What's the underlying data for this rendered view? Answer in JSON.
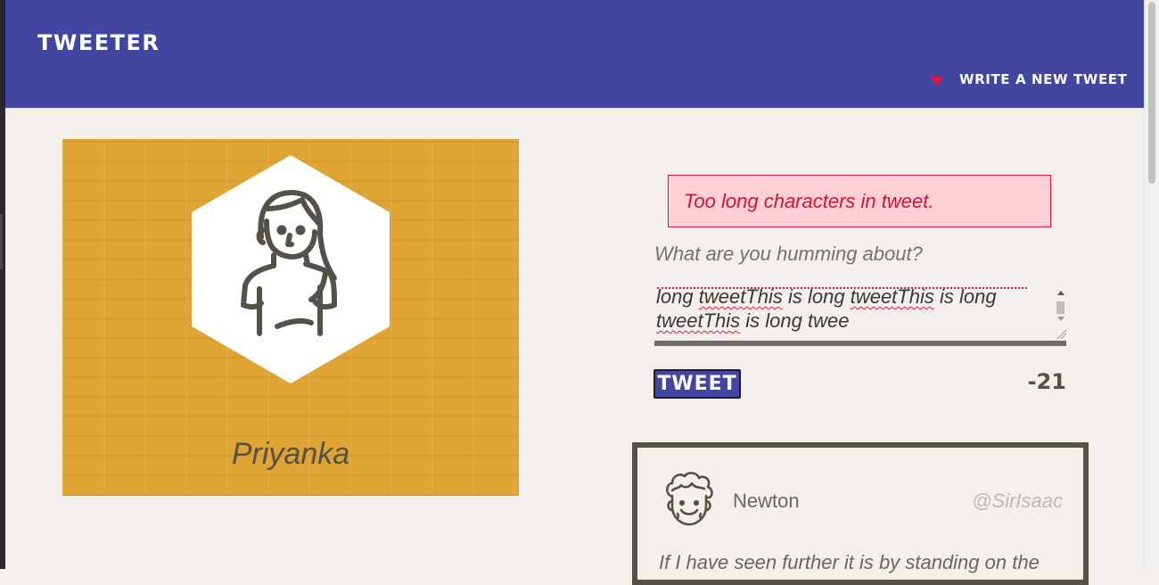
{
  "header": {
    "brand": "TWEETER",
    "write_link": "WRITE A NEW TWEET"
  },
  "profile": {
    "name": "Priyanka",
    "avatar_icon": "woman-avatar-icon",
    "background_color": "#e0a435"
  },
  "composer": {
    "error": "Too long characters in tweet.",
    "prompt": "What are you humming about?",
    "text_lines": [
      [
        "long ",
        "tweetThis",
        " is long ",
        "tweetThis",
        " is long"
      ],
      [
        "tweetThis",
        " is long twee"
      ]
    ],
    "button_label": "TWEET",
    "counter": "-21"
  },
  "tweets": [
    {
      "author": "Newton",
      "handle": "@SirIsaac",
      "text": "If I have seen further it is by standing on the",
      "avatar_icon": "curly-hair-man-avatar-icon"
    }
  ],
  "colors": {
    "header_bg": "#4346a1",
    "accent_red": "#e5163f",
    "page_bg": "#f3f0ec",
    "error_bg": "#ffd0d5"
  }
}
